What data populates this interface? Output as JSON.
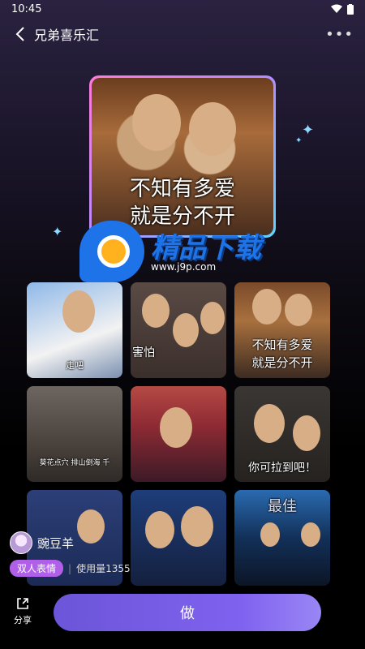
{
  "status_bar": {
    "time": "10:45"
  },
  "header": {
    "title": "兄弟喜乐汇"
  },
  "hero": {
    "caption_line1": "不知有多爱",
    "caption_line2": "就是分不开"
  },
  "watermark": {
    "brand": "精品下载",
    "url": "www.j9p.com"
  },
  "grid": [
    {
      "caption": "走吧"
    },
    {
      "caption": "害怕"
    },
    {
      "caption_line1": "不知有多爱",
      "caption_line2": "就是分不开"
    },
    {
      "caption": "葵花点穴  排山倒海  千"
    },
    {
      "caption": ""
    },
    {
      "caption": "你可拉到吧！"
    },
    {
      "caption": ""
    },
    {
      "caption": ""
    },
    {
      "caption": "最佳"
    }
  ],
  "author": {
    "name": "豌豆羊"
  },
  "tags": {
    "tag": "双人表情",
    "usage": "使用量1355"
  },
  "bottom": {
    "share_label": "分享",
    "make_label": "做"
  },
  "colors": {
    "accent": "#7f62ef",
    "tag": "#b060e8"
  }
}
